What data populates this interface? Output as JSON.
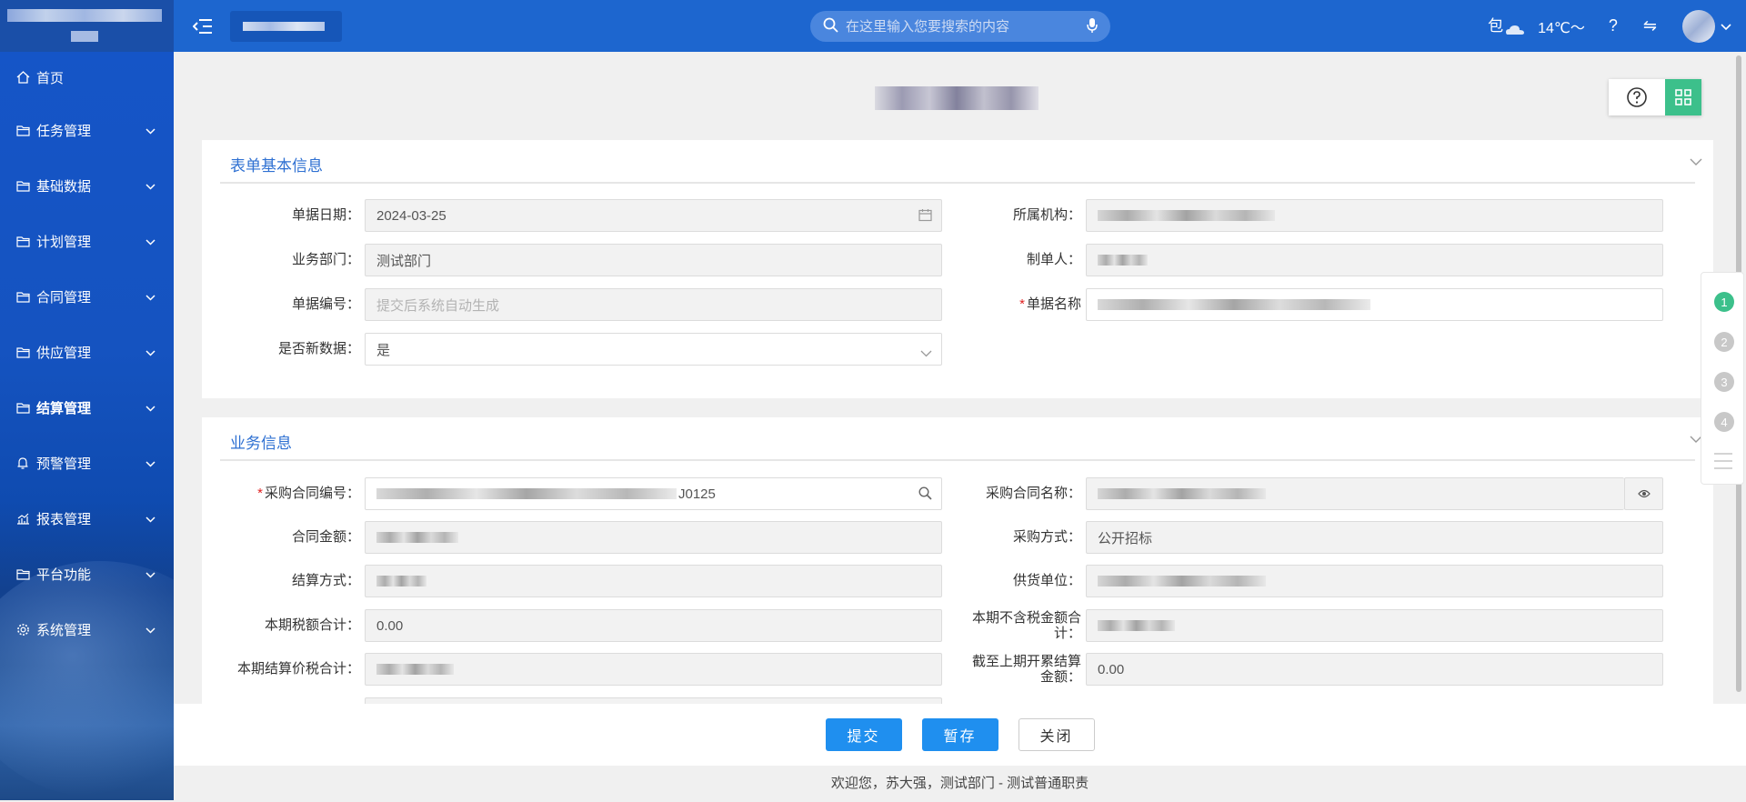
{
  "topbar": {
    "search_placeholder": "在这里输入您要搜索的内容",
    "weather_text": "包",
    "temperature": "14℃～",
    "help_label": "?",
    "switch_label": "⇋"
  },
  "sidebar": {
    "items": [
      {
        "label": "首页",
        "icon": "home-icon"
      },
      {
        "label": "任务管理",
        "icon": "folder-icon"
      },
      {
        "label": "基础数据",
        "icon": "folder-icon"
      },
      {
        "label": "计划管理",
        "icon": "folder-icon"
      },
      {
        "label": "合同管理",
        "icon": "folder-icon"
      },
      {
        "label": "供应管理",
        "icon": "folder-icon"
      },
      {
        "label": "结算管理",
        "icon": "folder-icon"
      },
      {
        "label": "预警管理",
        "icon": "bell-icon"
      },
      {
        "label": "报表管理",
        "icon": "chart-icon"
      },
      {
        "label": "平台功能",
        "icon": "folder-icon"
      },
      {
        "label": "系统管理",
        "icon": "gear-icon"
      }
    ]
  },
  "section1": {
    "title": "表单基本信息",
    "date_label": "单据日期：",
    "date_value": "2024-03-25",
    "org_label": "所属机构：",
    "dept_label": "业务部门：",
    "dept_value": "测试部门",
    "creator_label": "制单人：",
    "docno_label": "单据编号：",
    "docno_placeholder": "提交后系统自动生成",
    "docname_label": "单据名称",
    "isnew_label": "是否新数据：",
    "isnew_value": "是"
  },
  "section2": {
    "title": "业务信息",
    "contract_no_label": "采购合同编号：",
    "contract_no_suffix": "J0125",
    "contract_name_label": "采购合同名称：",
    "amount_label": "合同金额：",
    "method_label": "采购方式：",
    "method_value": "公开招标",
    "settle_label": "结算方式：",
    "supplier_label": "供货单位：",
    "tax_label": "本期税额合计：",
    "tax_value": "0.00",
    "notax_label_1": "本期不含税金额合",
    "notax_label_2": "计：",
    "total_label": "本期结算价税合计：",
    "prev_label_1": "截至上期开累结算",
    "prev_label_2": "金额：",
    "prev_value": "0.00"
  },
  "steps": [
    "1",
    "2",
    "3",
    "4"
  ],
  "footer": {
    "submit": "提交",
    "save": "暂存",
    "close": "关闭"
  },
  "status": "欢迎您，苏大强，测试部门 - 测试普通职责"
}
